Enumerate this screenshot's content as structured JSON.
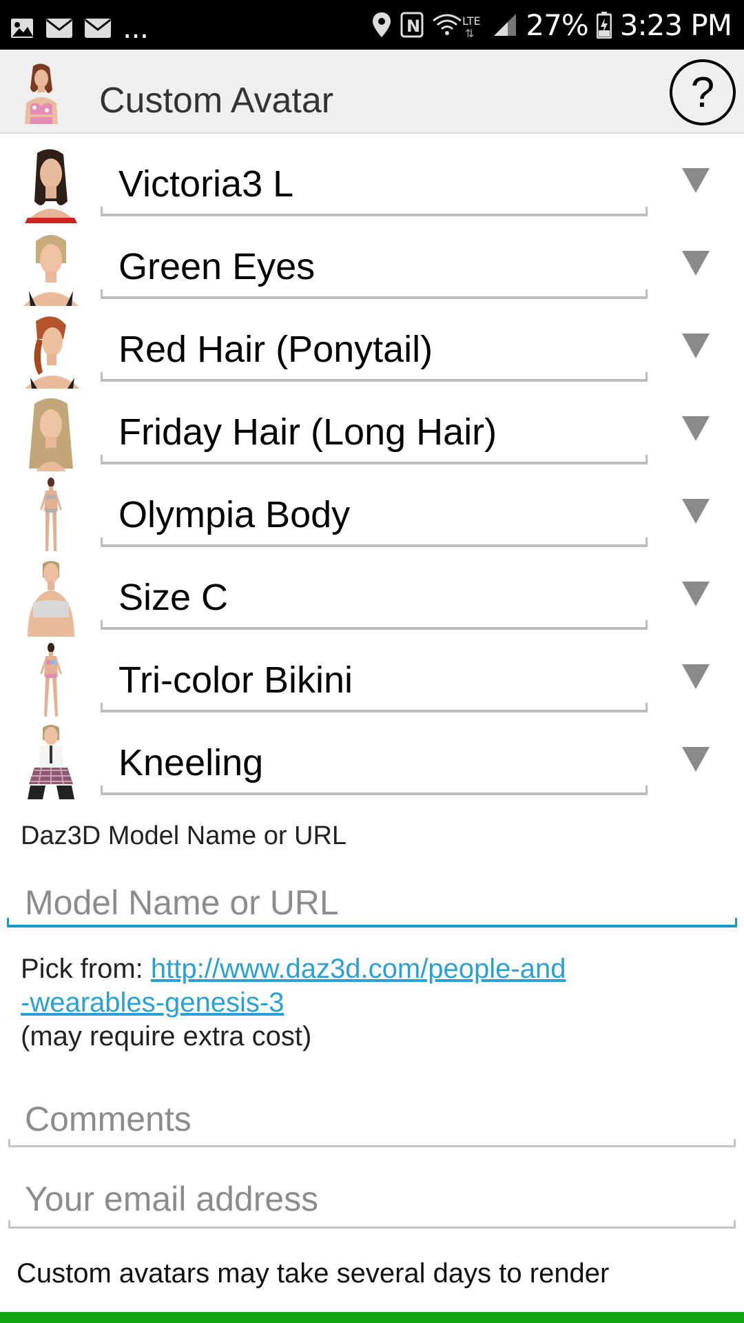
{
  "status_bar": {
    "notification_icons": [
      "image-icon",
      "mail-icon",
      "mail-icon"
    ],
    "overflow": "...",
    "battery": "27%",
    "time": "3:23 PM"
  },
  "app_bar": {
    "title": "Custom Avatar",
    "help_label": "?"
  },
  "options": [
    {
      "label": "Victoria3 L",
      "thumb": "female-head-dark-hair"
    },
    {
      "label": "Green Eyes",
      "thumb": "female-head-blonde-short"
    },
    {
      "label": "Red Hair (Ponytail)",
      "thumb": "female-head-red-ponytail"
    },
    {
      "label": "Friday Hair (Long Hair)",
      "thumb": "female-head-long-blonde"
    },
    {
      "label": "Olympia Body",
      "thumb": "full-body-figure"
    },
    {
      "label": "Size C",
      "thumb": "female-torso"
    },
    {
      "label": "Tri-color Bikini",
      "thumb": "full-body-bikini"
    },
    {
      "label": "Kneeling",
      "thumb": "kneeling-figure"
    }
  ],
  "model_field": {
    "label": "Daz3D Model Name or URL",
    "placeholder": "Model Name or URL"
  },
  "pick": {
    "prefix": "Pick from: ",
    "link_line1": "http://www.daz3d.com/people-and",
    "link_line2": "-wearables-genesis-3",
    "note": "(may require extra cost)"
  },
  "comments": {
    "placeholder": "Comments"
  },
  "email": {
    "placeholder": "Your email address"
  },
  "footer_note": "Custom avatars may take several days to render",
  "colors": {
    "accent": "#1a9bc9",
    "link": "#2aa1d5",
    "green_bar": "#11a411",
    "app_bar_bg": "#efefef"
  }
}
